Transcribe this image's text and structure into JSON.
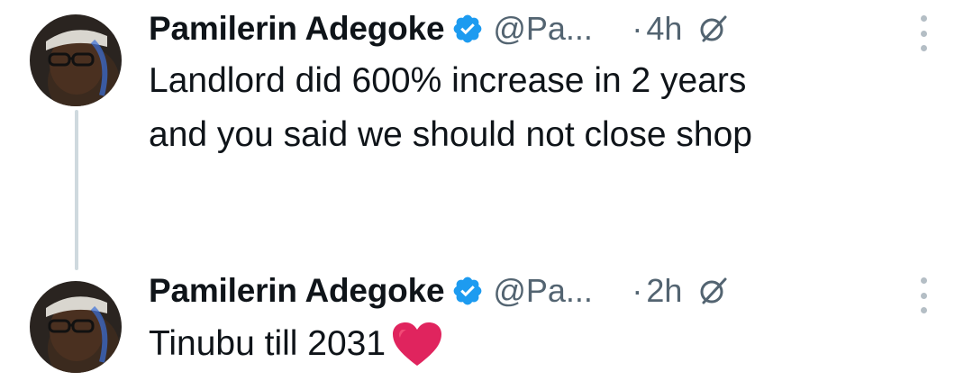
{
  "tweets": [
    {
      "author_name": "Pamilerin Adegoke",
      "handle": "@Pa...",
      "separator": "·",
      "time": "4h",
      "text_lines": [
        "Landlord did 600% increase in 2 years",
        "and you said we should not close shop"
      ],
      "icons": [
        "avatar",
        "verified-badge-icon",
        "grok-icon",
        "more-options-icon"
      ]
    },
    {
      "author_name": "Pamilerin Adegoke",
      "handle": "@Pa...",
      "separator": "·",
      "time": "2h",
      "text": "Tinubu till 2031",
      "icons": [
        "avatar",
        "verified-badge-icon",
        "grok-icon",
        "more-options-icon",
        "red-heart-icon"
      ]
    }
  ],
  "colors": {
    "text_primary": "#0f1419",
    "text_secondary": "#536471",
    "verified_blue": "#1d9bf0",
    "thread_line": "#cfd9de",
    "heart_red": "#e0245e"
  }
}
